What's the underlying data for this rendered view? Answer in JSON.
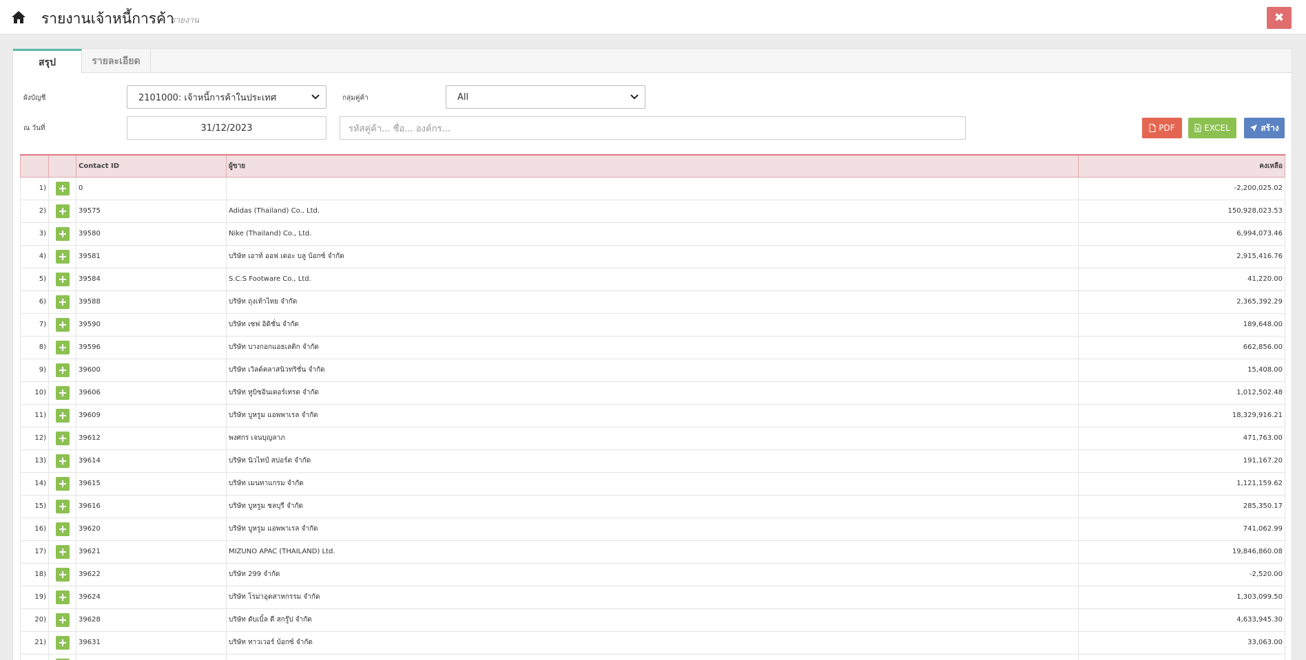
{
  "header": {
    "title": "รายงานเจ้าหนี้การค้า",
    "subtitle": "รายงาน"
  },
  "tabs": [
    {
      "label": "สรุป",
      "active": true
    },
    {
      "label": "รายละเอียด",
      "active": false
    }
  ],
  "filters": {
    "account_label": "ผังบัญชี",
    "account_value": "2101000: เจ้าหนี้การค้าในประเทศ",
    "group_label": "กลุ่มคู่ค้า",
    "group_value": "All",
    "date_label": "ณ วันที่",
    "date_value": "31/12/2023",
    "search_placeholder": "รหัสคู่ค้า... ชื่อ... องค์กร..."
  },
  "actions": {
    "pdf_label": "PDF",
    "excel_label": "EXCEL",
    "create_label": "สร้าง"
  },
  "table": {
    "columns": [
      "",
      "",
      "Contact ID",
      "ผู้ขาย",
      "คงเหลือ"
    ],
    "rows": [
      {
        "idx": "1)",
        "id": "0",
        "vendor": "",
        "balance": "-2,200,025.02"
      },
      {
        "idx": "2)",
        "id": "39575",
        "vendor": "Adidas (Thailand) Co., Ltd.",
        "balance": "150,928,023.53"
      },
      {
        "idx": "3)",
        "id": "39580",
        "vendor": "Nike (Thailand) Co., Ltd.",
        "balance": "6,994,073.46"
      },
      {
        "idx": "4)",
        "id": "39581",
        "vendor": "บริษัท เอาท์ ออฟ เดอะ บลู บ้อกซ์ จำกัด",
        "balance": "2,915,416.76"
      },
      {
        "idx": "5)",
        "id": "39584",
        "vendor": "S.C.S Footware Co., Ltd.",
        "balance": "41,220.00"
      },
      {
        "idx": "6)",
        "id": "39588",
        "vendor": "บริษัท ถุงเท้าไทย จำกัด",
        "balance": "2,365,392.29"
      },
      {
        "idx": "7)",
        "id": "39590",
        "vendor": "บริษัท เซฟ อิดิชั่น จำกัด",
        "balance": "189,648.00"
      },
      {
        "idx": "8)",
        "id": "39596",
        "vendor": "บริษัท บางกอกแอธเลติก จำกัด",
        "balance": "662,856.00"
      },
      {
        "idx": "9)",
        "id": "39600",
        "vendor": "บริษัท เวิลด์คลาสนิวทริชั่น จำกัด",
        "balance": "15,408.00"
      },
      {
        "idx": "10)",
        "id": "39606",
        "vendor": "บริษัท ทูบิซอินเตอร์เทรด จำกัด",
        "balance": "1,012,502.48"
      },
      {
        "idx": "11)",
        "id": "39609",
        "vendor": "บริษัท บูหรูม แอพพาเรล จำกัด",
        "balance": "18,329,916.21"
      },
      {
        "idx": "12)",
        "id": "39612",
        "vendor": "พงศกร เจนบุญลาภ",
        "balance": "471,763.00"
      },
      {
        "idx": "13)",
        "id": "39614",
        "vendor": "บริษัท นิวไทป์ สปอร์ต จำกัด",
        "balance": "191,167.20"
      },
      {
        "idx": "14)",
        "id": "39615",
        "vendor": "บริษัท เมนทาแกรม จำกัด",
        "balance": "1,121,159.62"
      },
      {
        "idx": "15)",
        "id": "39616",
        "vendor": "บริษัท บูหรูม ชลบุรี จำกัด",
        "balance": "285,350.17"
      },
      {
        "idx": "16)",
        "id": "39620",
        "vendor": "บริษัท บูหรูม แอพพาเรล จำกัด",
        "balance": "741,062.99"
      },
      {
        "idx": "17)",
        "id": "39621",
        "vendor": "MIZUNO APAC (THAILAND) Ltd.",
        "balance": "19,846,860.08"
      },
      {
        "idx": "18)",
        "id": "39622",
        "vendor": "บริษัท 299 จำกัด",
        "balance": "-2,520.00"
      },
      {
        "idx": "19)",
        "id": "39624",
        "vendor": "บริษัท โรม่าอุตสาหกรรม จำกัด",
        "balance": "1,303,099.50"
      },
      {
        "idx": "20)",
        "id": "39628",
        "vendor": "บริษัท ดับเบิ้ล ดี สกรู๊ป จำกัด",
        "balance": "4,633,945.30"
      },
      {
        "idx": "21)",
        "id": "39631",
        "vendor": "บริษัท ทาวเวอร์ บ้อกซ์ จำกัด",
        "balance": "33,063.00"
      },
      {
        "idx": "",
        "id": "",
        "vendor": "",
        "balance": ""
      }
    ]
  }
}
